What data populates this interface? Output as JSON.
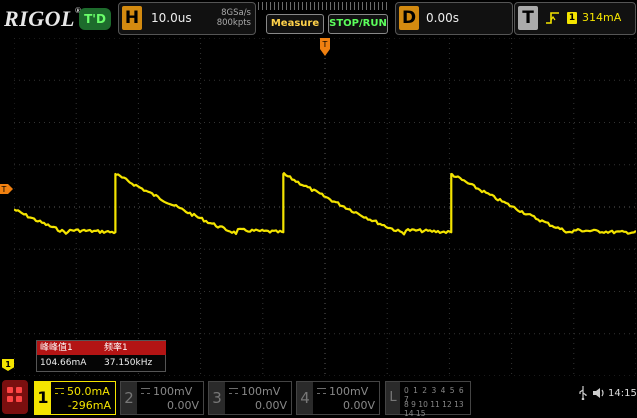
{
  "header": {
    "logo": "RIGOL",
    "status": "T'D",
    "horizontal": {
      "letter": "H",
      "timebase": "10.0us",
      "sample_rate": "8GSa/s",
      "memory_depth": "800kpts"
    },
    "buttons": {
      "measure": "Measure",
      "stop_run": "STOP/RUN"
    },
    "delay": {
      "letter": "D",
      "value": "0.00s"
    },
    "trigger": {
      "letter": "T",
      "source": "1",
      "level": "314mA",
      "slope_glyph": "⭜"
    }
  },
  "markers": {
    "trigger_left": "T",
    "channel_left": "1"
  },
  "measurements": {
    "labels": [
      "峰峰值1",
      "频率1"
    ],
    "values": [
      "104.66mA",
      "37.150kHz"
    ]
  },
  "channels": [
    {
      "num": "1",
      "scale": "50.0mA",
      "offset": "-296mA",
      "active": true
    },
    {
      "num": "2",
      "scale": "100mV",
      "offset": "0.00V",
      "active": false
    },
    {
      "num": "3",
      "scale": "100mV",
      "offset": "0.00V",
      "active": false
    },
    {
      "num": "4",
      "scale": "100mV",
      "offset": "0.00V",
      "active": false
    }
  ],
  "logic": {
    "num": "L",
    "row1": "0 1 2 3 4 5 6 7",
    "row2": "8 9 10 11 12 13 14 15"
  },
  "status_bar": {
    "usb_glyph": "⭍",
    "speaker_glyph": "🔈",
    "time": "14:15"
  },
  "colors": {
    "ch1": "#f4e400",
    "accent": "#d38a10",
    "measure_header": "#b31414",
    "stop_run": "#5cff5c"
  },
  "waveform": {
    "period_divs": 2.7,
    "rise_x_divs": [
      1.63,
      4.33,
      7.03
    ]
  }
}
